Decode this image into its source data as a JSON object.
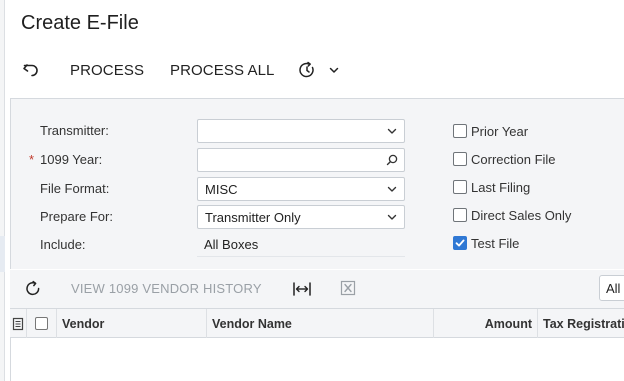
{
  "page": {
    "title": "Create E-File"
  },
  "toolbar": {
    "undo_icon": "undo-icon",
    "process_label": "PROCESS",
    "process_all_label": "PROCESS ALL",
    "schedule_icon": "schedule-icon",
    "chevron_icon": "chevron-down-icon"
  },
  "form": {
    "transmitter": {
      "label": "Transmitter:",
      "value": ""
    },
    "year": {
      "label": "1099 Year:",
      "value": "",
      "required_marker": "*"
    },
    "file_format": {
      "label": "File Format:",
      "value": "MISC"
    },
    "prepare_for": {
      "label": "Prepare For:",
      "value": "Transmitter Only"
    },
    "include": {
      "label": "Include:",
      "value": "All Boxes"
    }
  },
  "checkboxes": [
    {
      "label": "Prior Year",
      "checked": false
    },
    {
      "label": "Correction File",
      "checked": false
    },
    {
      "label": "Last Filing",
      "checked": false
    },
    {
      "label": "Direct Sales Only",
      "checked": false
    },
    {
      "label": "Test File",
      "checked": true
    }
  ],
  "grid_toolbar": {
    "refresh_icon": "refresh-icon",
    "history_label": "VIEW 1099 VENDOR HISTORY",
    "fit_icon": "fit-columns-icon",
    "excel_icon": "export-excel-icon",
    "filter_value": "All"
  },
  "grid": {
    "columns": [
      "Vendor",
      "Vendor Name",
      "Amount",
      "Tax Registrati"
    ]
  },
  "colors": {
    "accent": "#2f78d4",
    "required": "#c0392b",
    "panel_bg": "#f4f5f7",
    "disabled_text": "#9aa0a6"
  }
}
